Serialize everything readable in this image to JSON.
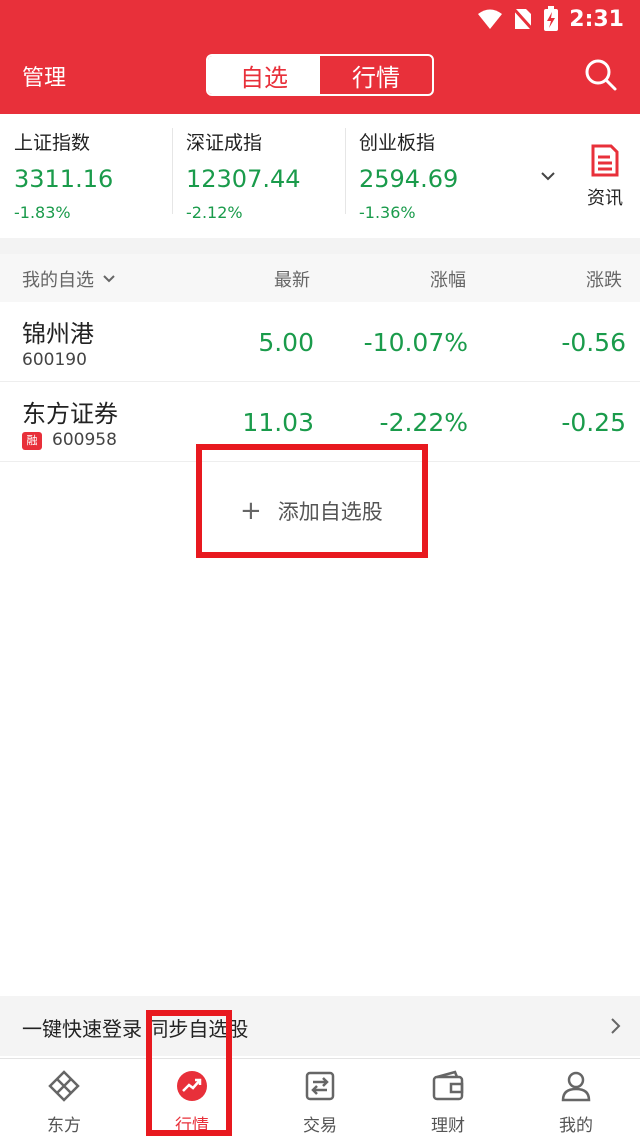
{
  "status_bar": {
    "time": "2:31"
  },
  "nav": {
    "manage_label": "管理",
    "segments": [
      "自选",
      "行情"
    ],
    "active_segment": "自选"
  },
  "indexes": [
    {
      "name": "上证指数",
      "price": "3311.16",
      "change": "-1.83%"
    },
    {
      "name": "深证成指",
      "price": "12307.44",
      "change": "-2.12%"
    },
    {
      "name": "创业板指",
      "price": "2594.69",
      "change": "-1.36%"
    }
  ],
  "news": {
    "label": "资讯"
  },
  "watchlist": {
    "columns": {
      "name": "我的自选",
      "price": "最新",
      "change_pct": "涨幅",
      "change_amt": "涨跌"
    },
    "rows": [
      {
        "name": "锦州港",
        "code": "600190",
        "badge": "",
        "price": "5.00",
        "change_pct": "-10.07%",
        "change_amt": "-0.56"
      },
      {
        "name": "东方证券",
        "code": "600958",
        "badge": "融",
        "price": "11.03",
        "change_pct": "-2.22%",
        "change_amt": "-0.25"
      }
    ],
    "add_label": "添加自选股"
  },
  "login_bar": {
    "text": "一键快速登录 同步自选股"
  },
  "tabbar": {
    "tabs": [
      {
        "label": "东方",
        "icon": "diamond-logo-icon"
      },
      {
        "label": "行情",
        "icon": "trend-icon"
      },
      {
        "label": "交易",
        "icon": "exchange-icon"
      },
      {
        "label": "理财",
        "icon": "wallet-icon"
      },
      {
        "label": "我的",
        "icon": "person-icon"
      }
    ],
    "active": "行情"
  },
  "colors": {
    "brand_red": "#e8303a",
    "down_green": "#1a9b4b",
    "highlight_box": "#e8191f"
  }
}
